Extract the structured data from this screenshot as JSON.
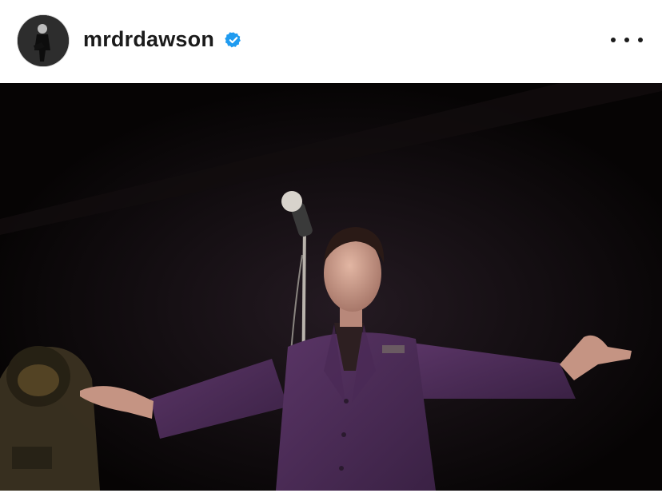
{
  "post": {
    "username": "mrdrdawson",
    "verified": true,
    "avatar_icon": "avatar-photo",
    "more_icon": "more-options-icon",
    "accent_color": "#1f9bf0",
    "text_color": "#1b1b1b"
  },
  "photo": {
    "scene_colors": {
      "background": "#070505",
      "suit": "#4a2a55",
      "skin": "#c89a86"
    }
  }
}
